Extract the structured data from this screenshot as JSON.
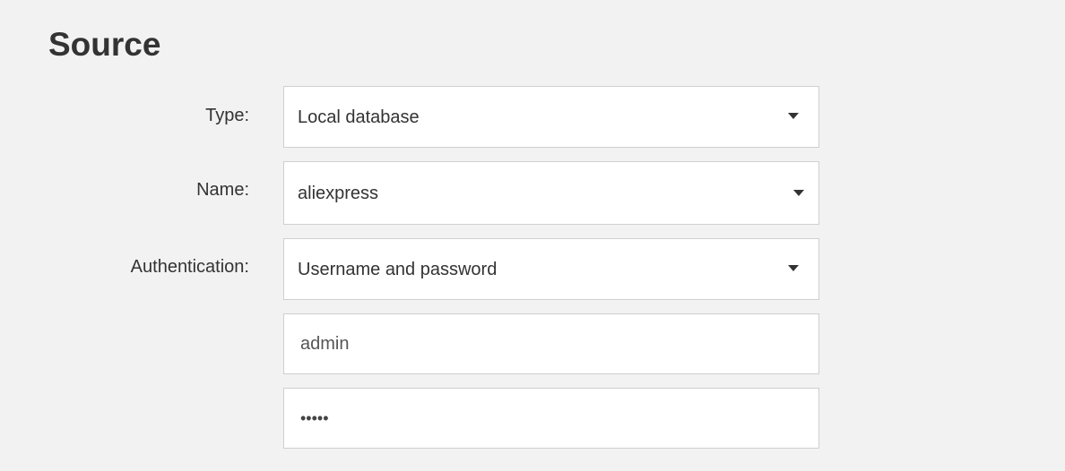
{
  "title": "Source",
  "fields": {
    "type": {
      "label": "Type:",
      "value": "Local database",
      "caret_icon": "caret-down-icon"
    },
    "name": {
      "label": "Name:",
      "value": "aliexpress",
      "caret_icon": "caret-down-icon"
    },
    "authentication": {
      "label": "Authentication:",
      "value": "Username and password",
      "caret_icon": "caret-down-icon"
    },
    "username": {
      "value": "admin"
    },
    "password": {
      "masked_value": "•••••"
    }
  },
  "colors": {
    "background": "#f2f2f2",
    "field_background": "#ffffff",
    "field_border": "#cfcfcf",
    "text": "#333333"
  }
}
